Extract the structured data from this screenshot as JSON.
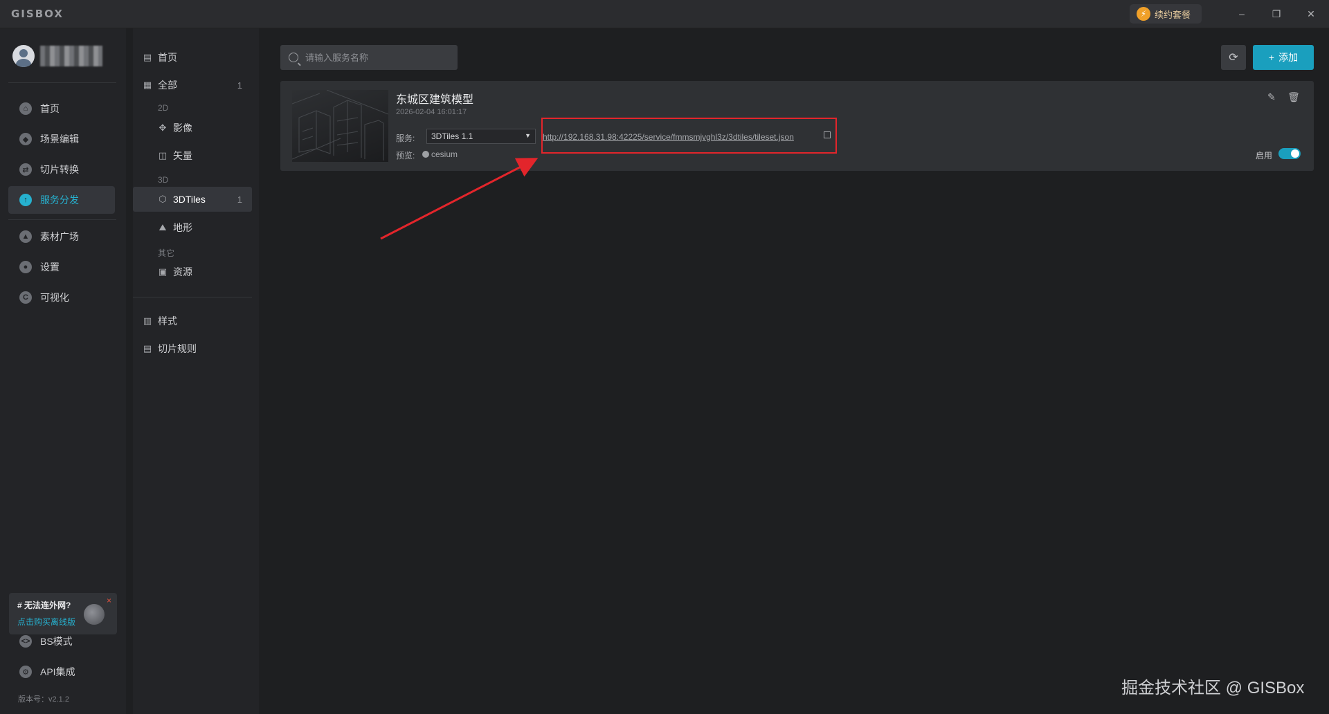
{
  "app": {
    "logo": "GISBOX"
  },
  "titlebar": {
    "renew_label": "续约套餐",
    "minimize": "–",
    "restore": "❐",
    "close": "✕"
  },
  "left_nav": {
    "items": [
      {
        "label": "首页",
        "icon": "home-icon",
        "glyph": "⌂"
      },
      {
        "label": "场景编辑",
        "icon": "cube-icon",
        "glyph": "◆"
      },
      {
        "label": "切片转换",
        "icon": "convert-icon",
        "glyph": "⇄"
      },
      {
        "label": "服务分发",
        "icon": "upload-icon",
        "glyph": "↑"
      },
      {
        "label": "素材广场",
        "icon": "image-icon",
        "glyph": "▲"
      },
      {
        "label": "设置",
        "icon": "settings-icon",
        "glyph": "●"
      },
      {
        "label": "可视化",
        "icon": "visualize-icon",
        "glyph": "C"
      }
    ],
    "promo": {
      "title": "# 无法连外网?",
      "link": "点击购买离线版",
      "close": "×"
    },
    "bottom_items": [
      {
        "label": "BS模式",
        "icon": "code-icon",
        "glyph": "<>"
      },
      {
        "label": "API集成",
        "icon": "api-icon",
        "glyph": "⚙"
      }
    ],
    "version": "版本号：v2.1.2"
  },
  "sub_nav": {
    "home": "首页",
    "all": {
      "label": "全部",
      "count": "1"
    },
    "group_2d": "2D",
    "imagery": "影像",
    "vector": "矢量",
    "group_3d": "3D",
    "tiles3d": {
      "label": "3DTiles",
      "count": "1"
    },
    "terrain": "地形",
    "group_other": "其它",
    "resource": "资源",
    "style": "样式",
    "tiling_rule": "切片规则"
  },
  "toolbar": {
    "search_placeholder": "请输入服务名称",
    "add_label": "添加"
  },
  "service_card": {
    "name": "东城区建筑模型",
    "date": "2026-02-04 16:01:17",
    "service_label": "服务:",
    "service_type": "3DTiles 1.1",
    "url": "http://192.168.31.98:42225/service/fmmsmjvghl3z/3dtiles/tileset.json",
    "preview_label": "预览:",
    "preview_value": "cesium",
    "enable_label": "启用",
    "enabled": true
  },
  "colors": {
    "accent": "#1a9fbe",
    "highlight": "#e3252b",
    "background": "#1e1f21"
  },
  "watermark": "掘金技术社区 @ GISBox"
}
